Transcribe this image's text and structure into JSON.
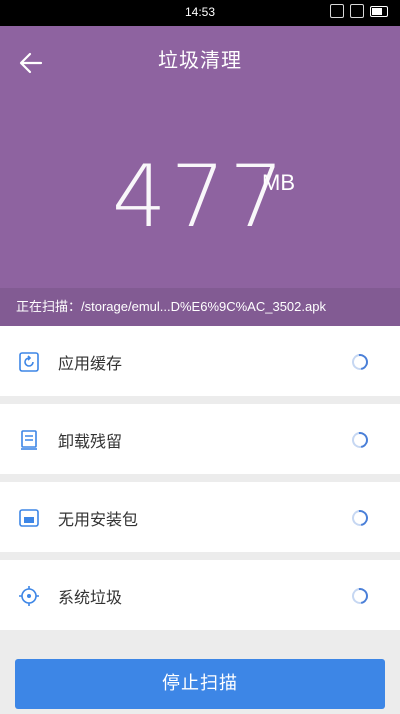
{
  "statusbar": {
    "time": "14:53"
  },
  "header": {
    "title": "垃圾清理",
    "size_value": "477",
    "size_unit": "MB",
    "scan_status": "正在扫描：/storage/emul...D%E6%9C%AC_3502.apk"
  },
  "list": {
    "items": [
      {
        "label": "应用缓存",
        "icon": "refresh-cache-icon"
      },
      {
        "label": "卸载残留",
        "icon": "uninstall-residue-icon"
      },
      {
        "label": "无用安装包",
        "icon": "package-icon"
      },
      {
        "label": "系统垃圾",
        "icon": "system-target-icon"
      }
    ]
  },
  "footer": {
    "stop_label": "停止扫描"
  },
  "colors": {
    "header_bg": "#8e63a0",
    "accent_blue": "#3d86e6"
  }
}
